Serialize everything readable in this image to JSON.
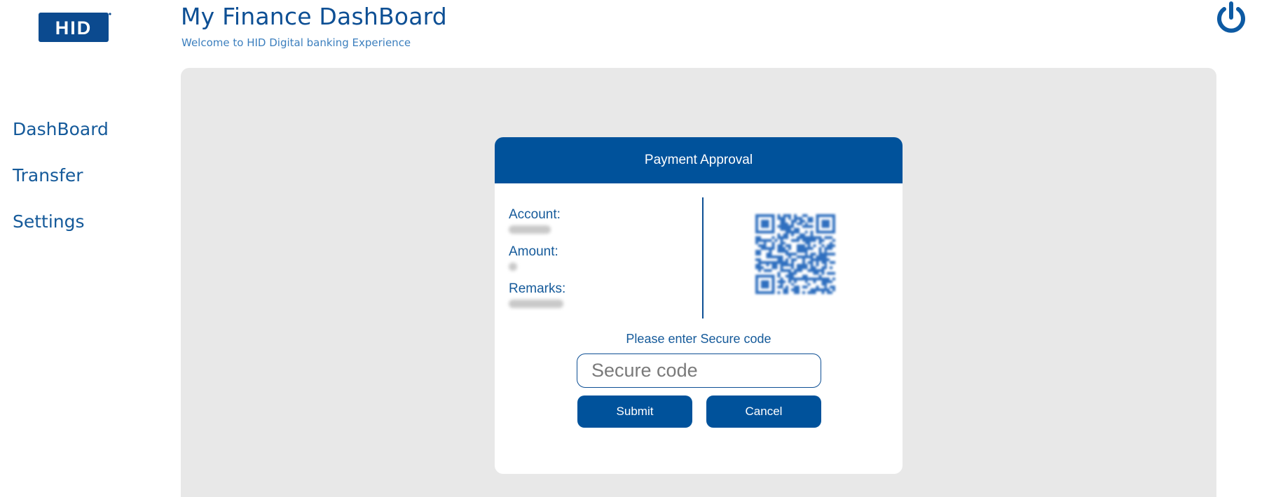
{
  "header": {
    "logo_text": "HID",
    "title": "My Finance DashBoard",
    "subtitle": "Welcome to HID Digital banking Experience",
    "power_icon": "power-icon"
  },
  "sidebar": {
    "items": [
      {
        "label": "DashBoard"
      },
      {
        "label": "Transfer"
      },
      {
        "label": "Settings"
      }
    ]
  },
  "payment": {
    "title": "Payment Approval",
    "account_label": "Account:",
    "amount_label": "Amount:",
    "remarks_label": "Remarks:",
    "secure_prompt": "Please enter Secure code",
    "code_placeholder": "Secure code",
    "submit_label": "Submit",
    "cancel_label": "Cancel",
    "qr_icon": "qr-code-icon"
  },
  "colors": {
    "brand_blue": "#00529b",
    "text_blue": "#155a9a",
    "panel_gray": "#e8e8e8"
  }
}
